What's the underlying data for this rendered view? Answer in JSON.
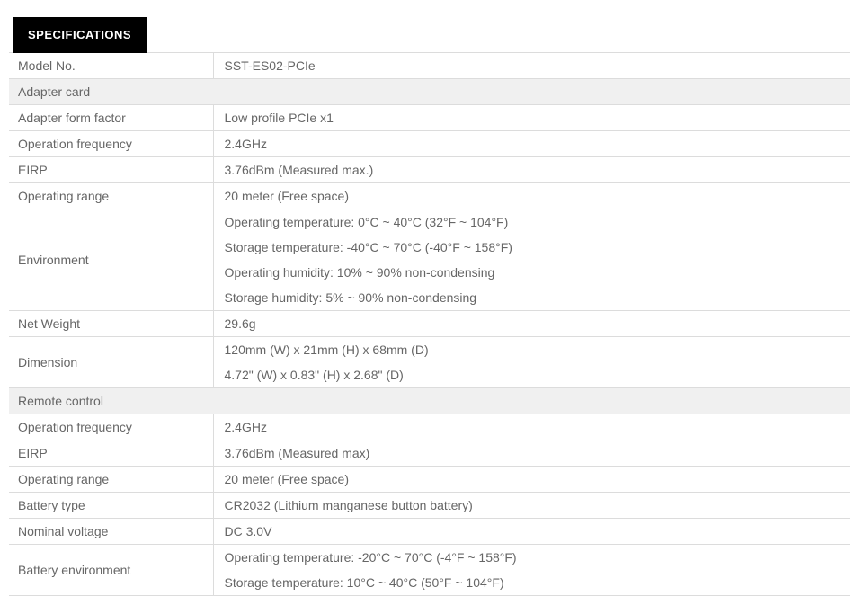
{
  "header": {
    "tab_label": "SPECIFICATIONS"
  },
  "colors": {
    "tab_bg": "#000000",
    "tab_text": "#ffffff",
    "section_bg": "#f0f0f0",
    "border": "#dcdcdc",
    "text": "#666666",
    "page_bg": "#ffffff"
  },
  "table": {
    "rows": [
      {
        "type": "data",
        "label": "Model No.",
        "values": [
          "SST-ES02-PCIe"
        ]
      },
      {
        "type": "section",
        "label": "Adapter card"
      },
      {
        "type": "data",
        "label": "Adapter form factor",
        "values": [
          "Low profile PCIe x1"
        ]
      },
      {
        "type": "data",
        "label": "Operation frequency",
        "values": [
          "2.4GHz"
        ]
      },
      {
        "type": "data",
        "label": "EIRP",
        "values": [
          "3.76dBm (Measured max.)"
        ]
      },
      {
        "type": "data",
        "label": "Operating range",
        "values": [
          "20 meter (Free space)"
        ]
      },
      {
        "type": "data",
        "label": "Environment",
        "values": [
          "Operating temperature: 0°C ~ 40°C (32°F ~ 104°F)",
          "Storage temperature: -40°C ~ 70°C (-40°F ~ 158°F)",
          "Operating humidity: 10% ~ 90% non-condensing",
          "Storage humidity: 5% ~ 90% non-condensing"
        ]
      },
      {
        "type": "data",
        "label": "Net Weight",
        "values": [
          "29.6g"
        ]
      },
      {
        "type": "data",
        "label": "Dimension",
        "values": [
          "120mm (W) x 21mm (H) x 68mm (D)",
          "4.72\" (W) x 0.83\" (H) x 2.68\" (D)"
        ]
      },
      {
        "type": "section",
        "label": "Remote control"
      },
      {
        "type": "data",
        "label": "Operation frequency",
        "values": [
          "2.4GHz"
        ]
      },
      {
        "type": "data",
        "label": "EIRP",
        "values": [
          "3.76dBm (Measured max)"
        ]
      },
      {
        "type": "data",
        "label": "Operating range",
        "values": [
          "20 meter (Free space)"
        ]
      },
      {
        "type": "data",
        "label": "Battery type",
        "values": [
          "CR2032 (Lithium manganese button battery)"
        ]
      },
      {
        "type": "data",
        "label": "Nominal voltage",
        "values": [
          "DC 3.0V"
        ]
      },
      {
        "type": "data",
        "label": "Battery environment",
        "values": [
          "Operating temperature: -20°C ~ 70°C (-4°F ~ 158°F)",
          "Storage temperature: 10°C ~ 40°C (50°F ~ 104°F)"
        ]
      }
    ]
  }
}
